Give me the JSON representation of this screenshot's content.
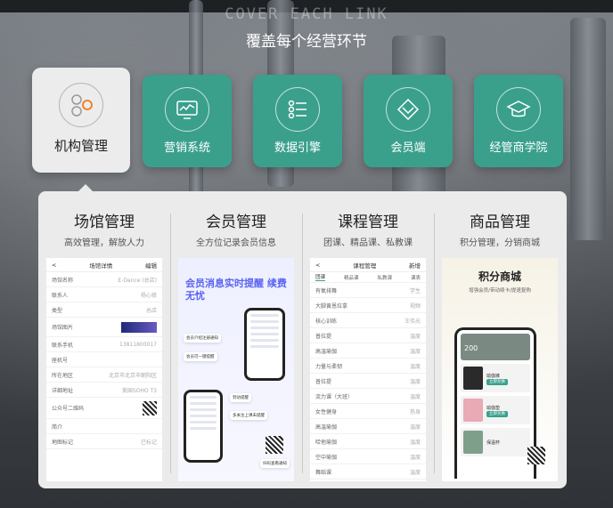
{
  "background_text": "COVER EACH LINK",
  "title": "覆盖每个经营环节",
  "tabs": [
    {
      "label": "机构管理",
      "icon": "molecule-icon",
      "active": true
    },
    {
      "label": "营销系统",
      "icon": "monitor-chart-icon",
      "active": false
    },
    {
      "label": "数据引擎",
      "icon": "list-icon",
      "active": false
    },
    {
      "label": "会员端",
      "icon": "diamond-icon",
      "active": false
    },
    {
      "label": "经管商学院",
      "icon": "graduation-cap-icon",
      "active": false
    }
  ],
  "columns": [
    {
      "title": "场馆管理",
      "subtitle": "高效管理，解放人力"
    },
    {
      "title": "会员管理",
      "subtitle": "全方位记录会员信息"
    },
    {
      "title": "课程管理",
      "subtitle": "团课、精品课、私教课"
    },
    {
      "title": "商品管理",
      "subtitle": "积分管理，分销商城"
    }
  ],
  "venue_shot": {
    "back": "<",
    "header": "场馆详情",
    "edit": "编辑",
    "rows": [
      {
        "label": "场馆名称",
        "value": "E-Dance (总店)"
      },
      {
        "label": "联系人",
        "value": "杨心修"
      },
      {
        "label": "类型",
        "value": "总店"
      },
      {
        "label": "场馆图片",
        "value": ""
      },
      {
        "label": "联系手机",
        "value": "13811800017"
      },
      {
        "label": "座机号",
        "value": ""
      },
      {
        "label": "所在地区",
        "value": "北京市北京市朝阳区"
      },
      {
        "label": "详细地址",
        "value": "美国SOHO T3"
      },
      {
        "label": "公众号二维码",
        "value": ""
      },
      {
        "label": "简介",
        "value": ""
      },
      {
        "label": "地图标记",
        "value": "已标记"
      }
    ]
  },
  "member_shot": {
    "headline": "会员消息实时提醒 续费无忧",
    "bubbles": [
      "会员介绍注册通知",
      "会员可一键提醒",
      "到访提醒",
      "多关注上课未提醒",
      "扫码查看通知"
    ]
  },
  "course_shot": {
    "back": "<",
    "header": "课程管理",
    "add": "新增",
    "tabs": [
      "团课",
      "精品课",
      "私教课",
      "课表"
    ],
    "rows": [
      {
        "label": "有氧排舞",
        "value": "学生"
      },
      {
        "label": "大脚黄恩拉拿",
        "value": "视频"
      },
      {
        "label": "核心训练",
        "value": "王伟光"
      },
      {
        "label": "普拉提",
        "value": "温度"
      },
      {
        "label": "高温瑜伽",
        "value": "温度"
      },
      {
        "label": "力量与柔韧",
        "value": "温度"
      },
      {
        "label": "普拉提",
        "value": "温度"
      },
      {
        "label": "流力课（大班）",
        "value": "温度"
      },
      {
        "label": "女性健身",
        "value": "热身"
      },
      {
        "label": "高温瑜伽",
        "value": "温度"
      },
      {
        "label": "哈他瑜伽",
        "value": "温度"
      },
      {
        "label": "空中瑜伽",
        "value": "温度"
      },
      {
        "label": "舞蹈课",
        "value": "温度"
      }
    ]
  },
  "goods_shot": {
    "headline": "积分商城",
    "sub": "增强会员/带动续卡/提速复购",
    "points": "200",
    "products": [
      {
        "name": "瑜伽裤",
        "button": "立即兑换"
      },
      {
        "name": "瑜伽垫",
        "button": "立即兑换"
      },
      {
        "name": "保温杯",
        "button": ""
      }
    ]
  },
  "colors": {
    "accent": "#3aa08c",
    "active_tab": "#ececec",
    "panel": "#ebebeb"
  }
}
